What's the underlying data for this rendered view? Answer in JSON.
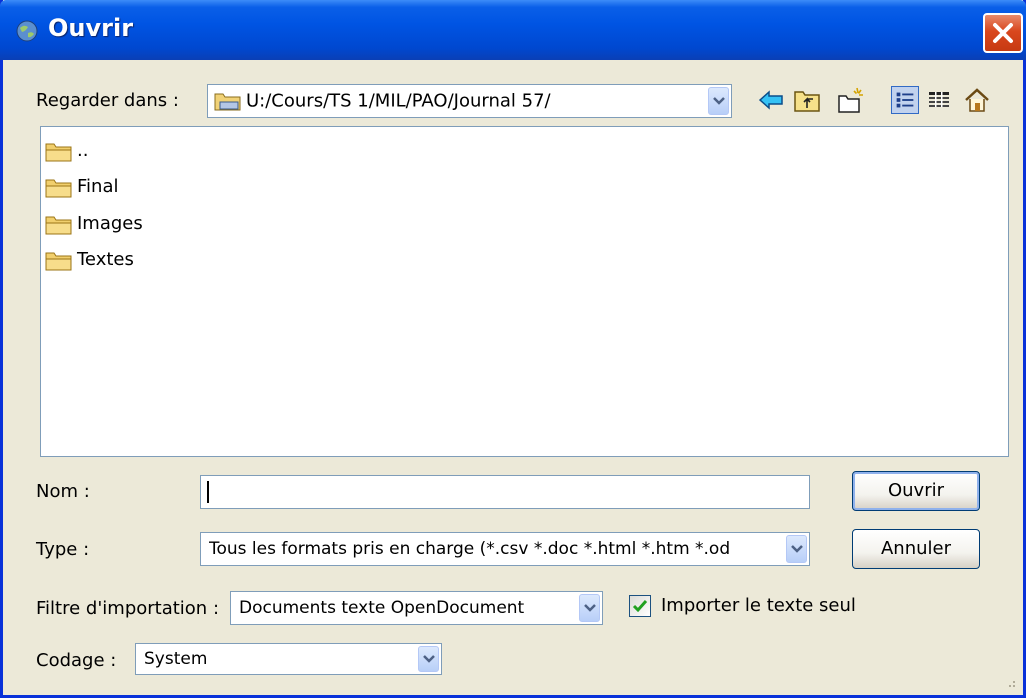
{
  "window": {
    "title": "Ouvrir",
    "title_icon": "globe-icon",
    "close_icon": "close-icon"
  },
  "lookin": {
    "label": "Regarder dans :",
    "path": "U:/Cours/TS 1/MIL/PAO/Journal 57/",
    "icon": "folder-icon"
  },
  "toolbar": {
    "icons": [
      "back-arrow-icon",
      "up-folder-icon",
      "new-folder-icon",
      "list-view-icon",
      "details-view-icon",
      "home-icon"
    ]
  },
  "files": [
    {
      "name": "..",
      "icon": "folder-icon"
    },
    {
      "name": "Final",
      "icon": "folder-icon"
    },
    {
      "name": "Images",
      "icon": "folder-icon"
    },
    {
      "name": "Textes",
      "icon": "folder-icon"
    }
  ],
  "name_field": {
    "label": "Nom :",
    "value": ""
  },
  "type_field": {
    "label": "Type :",
    "value": "Tous les formats pris en charge (*.csv *.doc *.html *.htm *.od"
  },
  "filter_field": {
    "label": "Filtre d'importation :",
    "value": "Documents texte OpenDocument"
  },
  "import_text_only": {
    "label": "Importer le texte seul",
    "checked": true
  },
  "encoding_field": {
    "label": "Codage :",
    "value": "System"
  },
  "buttons": {
    "open": "Ouvrir",
    "cancel": "Annuler"
  },
  "colors": {
    "title_bar": "#0054e3",
    "close_button": "#d9471d",
    "dialog_bg": "#ece9d8",
    "check": "#21a121"
  }
}
